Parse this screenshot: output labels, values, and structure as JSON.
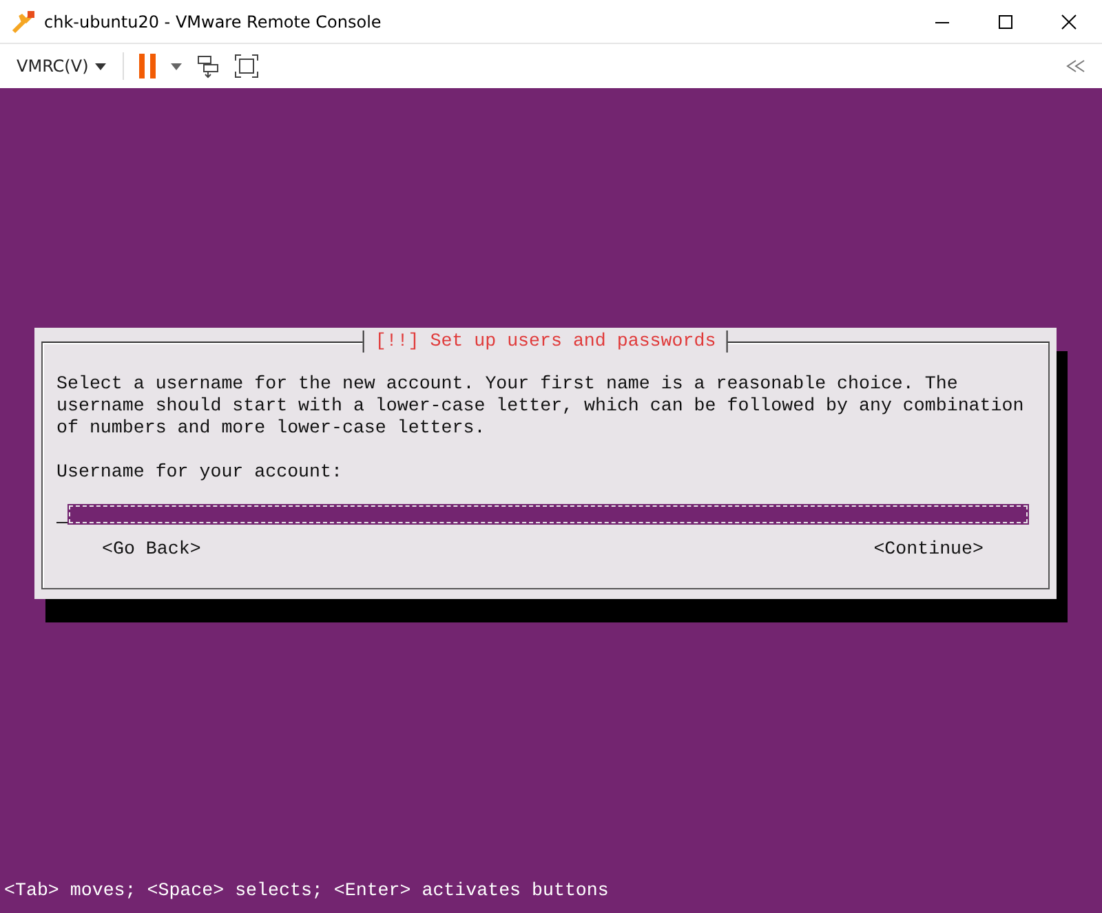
{
  "window": {
    "title": "chk-ubuntu20 - VMware Remote Console"
  },
  "toolbar": {
    "menu_label": "VMRC(V)",
    "paused": true
  },
  "dialog": {
    "title": "[!!] Set up users and passwords",
    "message": "Select a username for the new account. Your first name is a reasonable choice. The username should start with a lower-case letter, which can be followed by any combination of numbers and more lower-case letters.",
    "field_label": "Username for your account:",
    "buttons": [
      "<Go Back>",
      "<Continue>"
    ]
  },
  "status_line": "<Tab> moves; <Space> selects; <Enter> activates buttons"
}
